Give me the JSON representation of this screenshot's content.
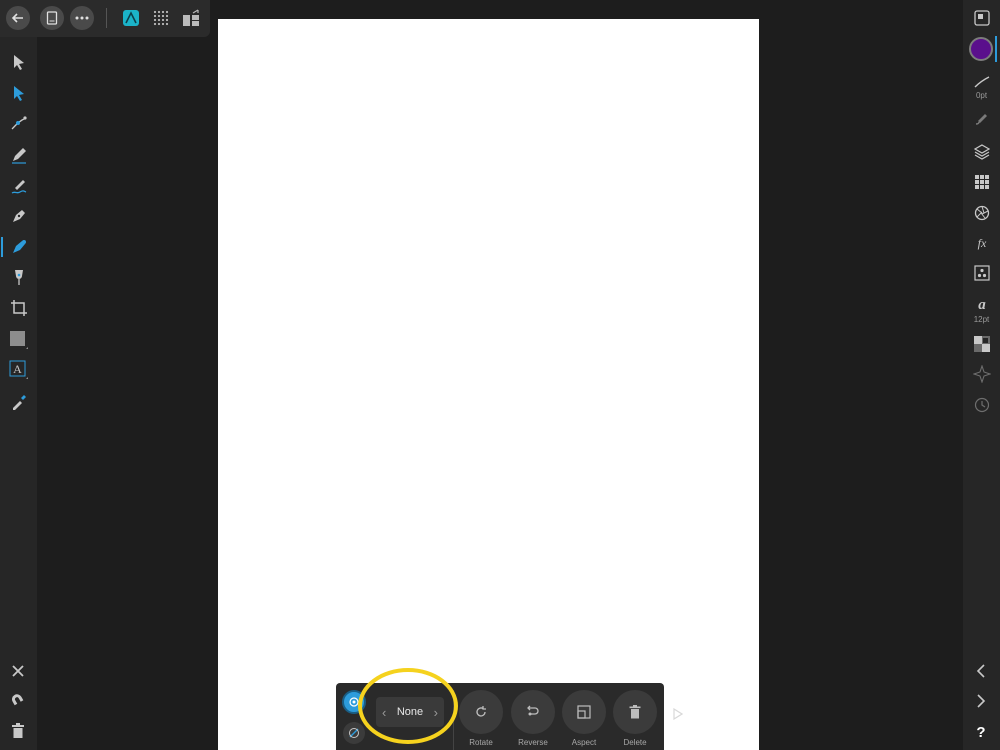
{
  "context_toolbar": {
    "stepper_value": "None",
    "actions": [
      {
        "id": "rotate",
        "label": "Rotate"
      },
      {
        "id": "reverse",
        "label": "Reverse"
      },
      {
        "id": "aspect",
        "label": "Aspect"
      },
      {
        "id": "delete",
        "label": "Delete"
      }
    ]
  },
  "studio": {
    "stroke_width_label": "0pt",
    "font_size_label": "12pt",
    "help_label": "?"
  },
  "colors": {
    "accent": "#2d9cdb",
    "fill_swatch": "#5a0f8c",
    "highlight": "#f5d21e"
  }
}
